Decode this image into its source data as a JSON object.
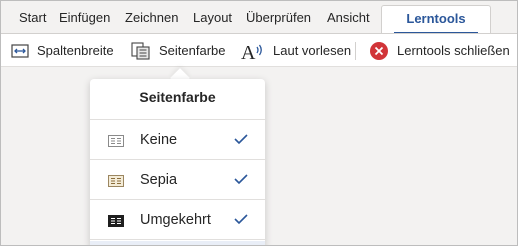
{
  "tabs": [
    {
      "label": "Start"
    },
    {
      "label": "Einfügen"
    },
    {
      "label": "Zeichnen"
    },
    {
      "label": "Layout"
    },
    {
      "label": "Überprüfen"
    },
    {
      "label": "Ansicht"
    },
    {
      "label": "Lerntools",
      "active": true
    }
  ],
  "ribbon": {
    "column_width_label": "Spaltenbreite",
    "page_color_label": "Seitenfarbe",
    "read_aloud_label": "Laut vorlesen",
    "close_label": "Lerntools schließen"
  },
  "page_color_menu": {
    "title": "Seitenfarbe",
    "options": [
      {
        "label": "Keine",
        "checked": true
      },
      {
        "label": "Sepia",
        "checked": true
      },
      {
        "label": "Umgekehrt",
        "checked": true
      }
    ]
  },
  "colors": {
    "accent": "#2b579a",
    "close_red": "#d13438",
    "check_blue": "#2b579a"
  },
  "icons": [
    "column-width-icon",
    "page-color-icon",
    "read-aloud-icon",
    "close-circle-icon",
    "checkmark-icon"
  ]
}
